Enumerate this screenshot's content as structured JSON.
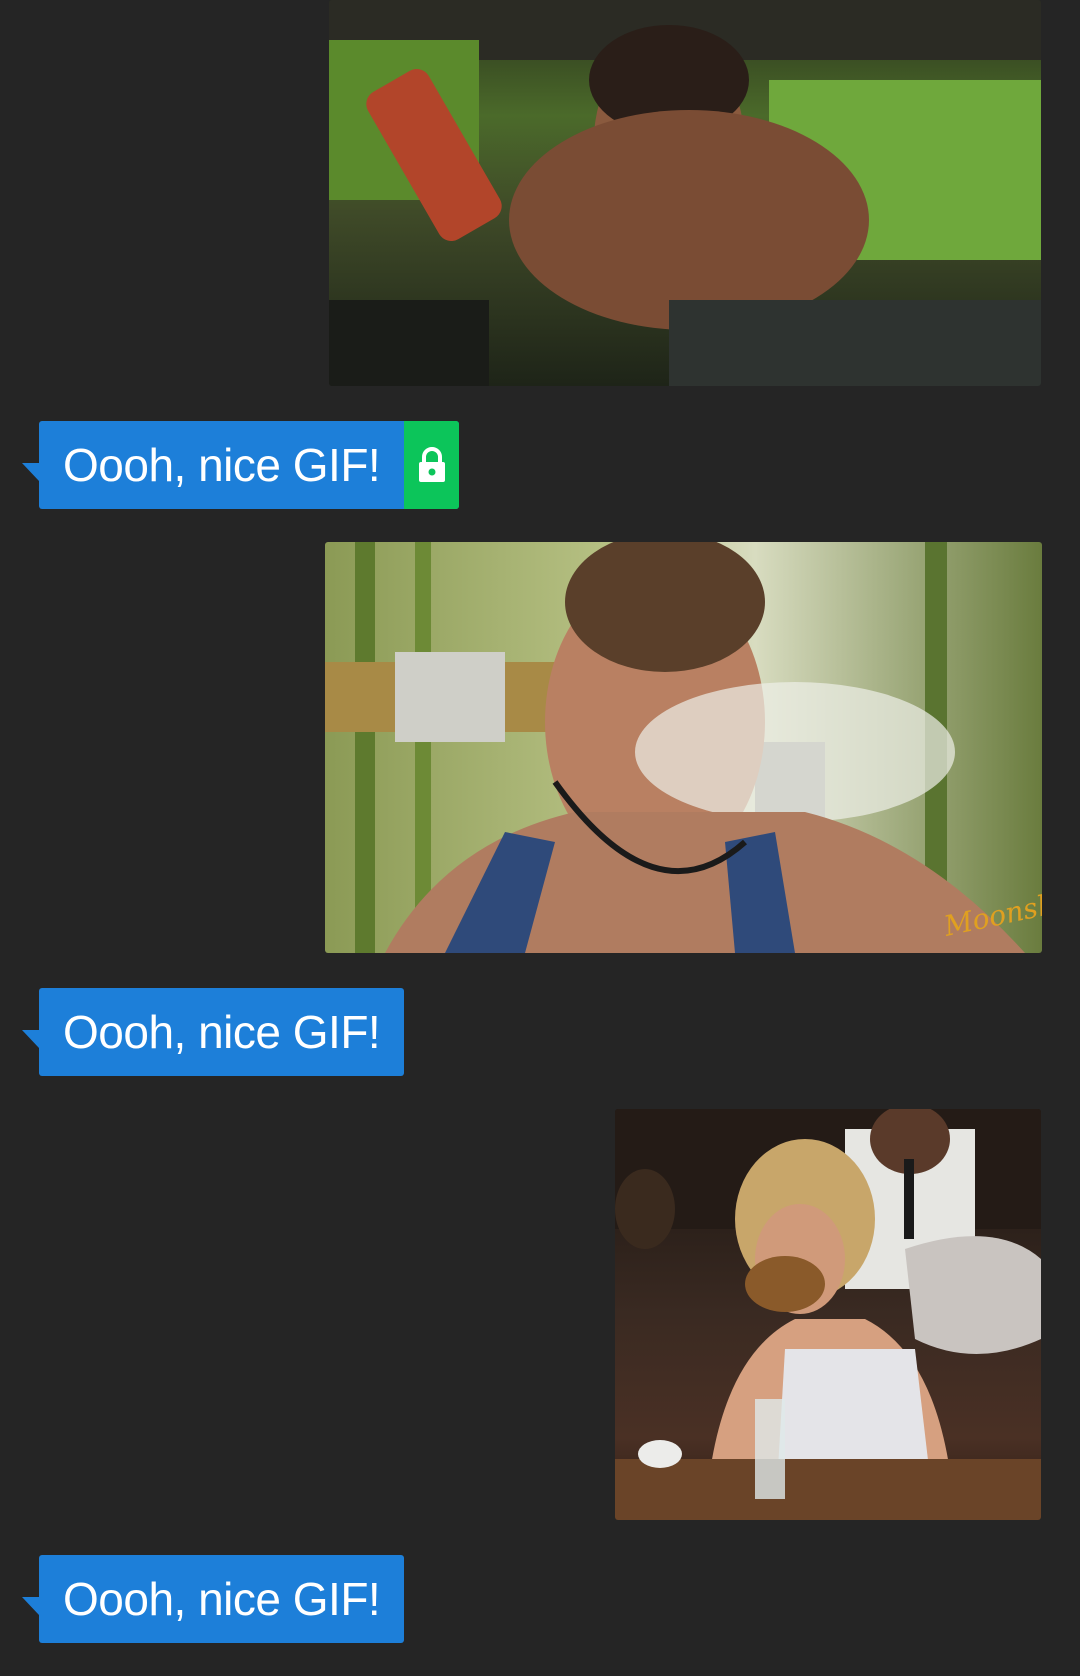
{
  "messages": [
    {
      "type": "gif",
      "direction": "incoming",
      "description": "man pouring drink"
    },
    {
      "type": "text",
      "direction": "outgoing",
      "text": "Oooh, nice GIF!",
      "icon": "lock-icon",
      "icon_color": "#0cc55a"
    },
    {
      "type": "gif",
      "direction": "incoming",
      "description": "man exhaling smoke"
    },
    {
      "type": "text",
      "direction": "outgoing",
      "text": "Oooh, nice GIF!"
    },
    {
      "type": "gif",
      "direction": "incoming",
      "description": "woman eating burger"
    },
    {
      "type": "text",
      "direction": "outgoing",
      "text": "Oooh, nice GIF!"
    }
  ],
  "colors": {
    "background": "#252525",
    "bubble": "#1d7fd9",
    "lock": "#0cc55a"
  }
}
